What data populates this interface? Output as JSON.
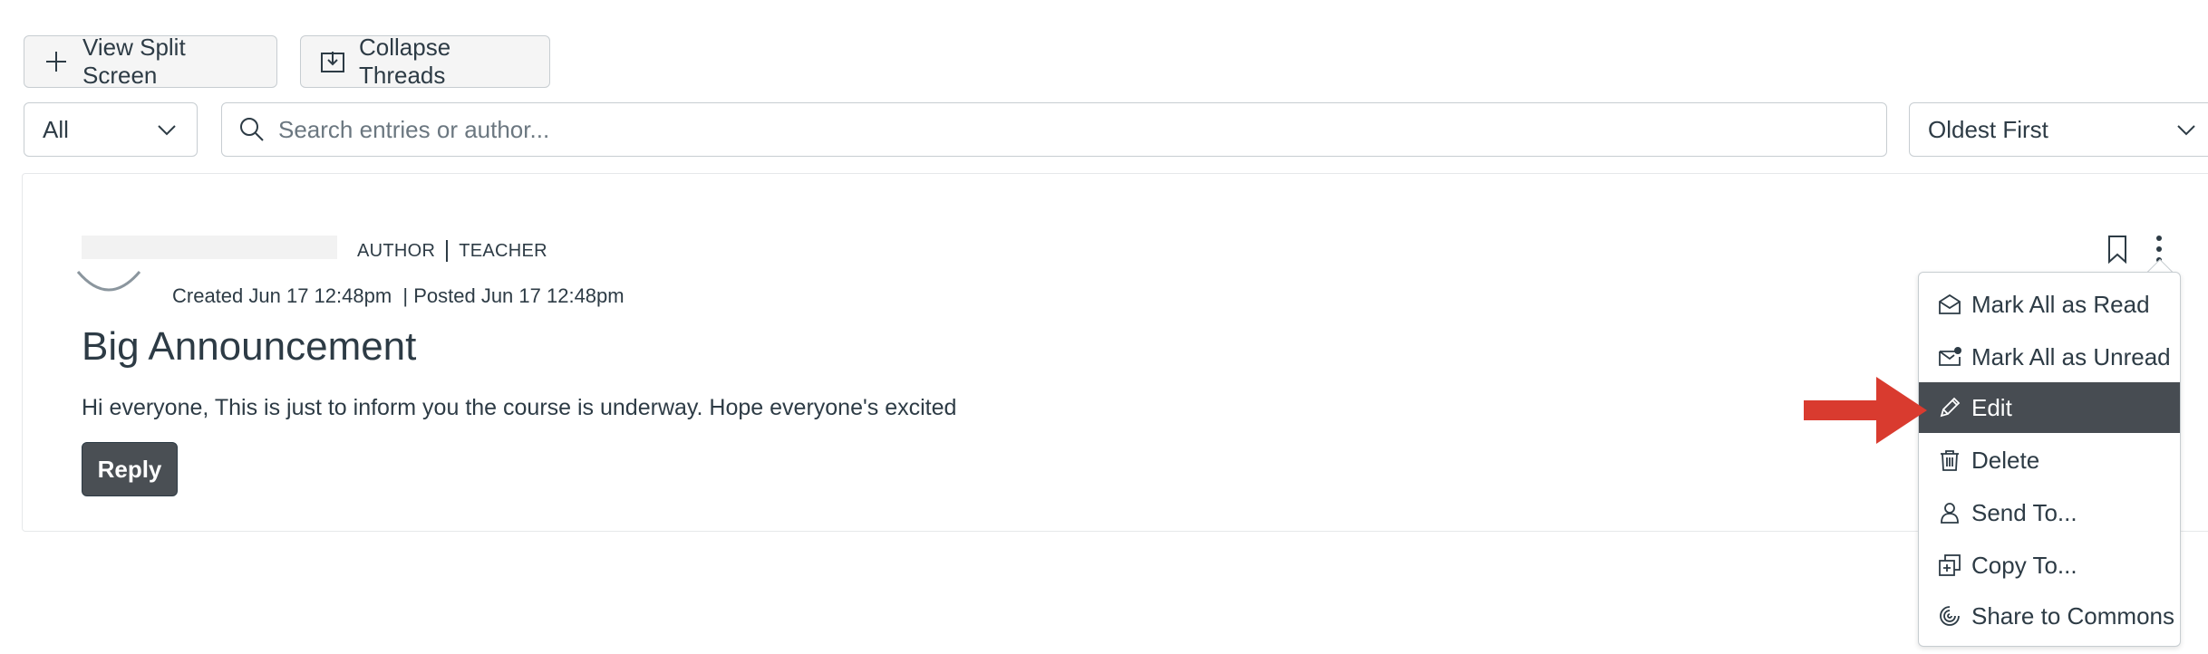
{
  "toolbar": {
    "split_label": "View Split Screen",
    "collapse_label": "Collapse Threads"
  },
  "filter": {
    "selected": "All"
  },
  "search": {
    "placeholder": "Search entries or author..."
  },
  "sort": {
    "selected": "Oldest First"
  },
  "entry": {
    "role_author": "AUTHOR",
    "role_teacher": "TEACHER",
    "dates": "Created Jun 17 12:48pm  | Posted Jun 17 12:48pm",
    "title": "Big Announcement",
    "body": "Hi everyone, This is just to inform you the course is underway. Hope everyone's excited",
    "reply_label": "Reply"
  },
  "menu": {
    "items": [
      {
        "label": "Mark All as Read",
        "icon": "envelope-open-icon"
      },
      {
        "label": "Mark All as Unread",
        "icon": "envelope-unread-icon"
      },
      {
        "label": "Edit",
        "icon": "pencil-icon",
        "active": true
      },
      {
        "label": "Delete",
        "icon": "trash-icon"
      },
      {
        "label": "Send To...",
        "icon": "user-icon"
      },
      {
        "label": "Copy To...",
        "icon": "copy-icon"
      },
      {
        "label": "Share to Commons",
        "icon": "commons-icon"
      }
    ]
  },
  "colors": {
    "menu_active_bg": "#474c52",
    "annotation_arrow": "#d93b2f",
    "reply_bg": "#4a4f54"
  }
}
